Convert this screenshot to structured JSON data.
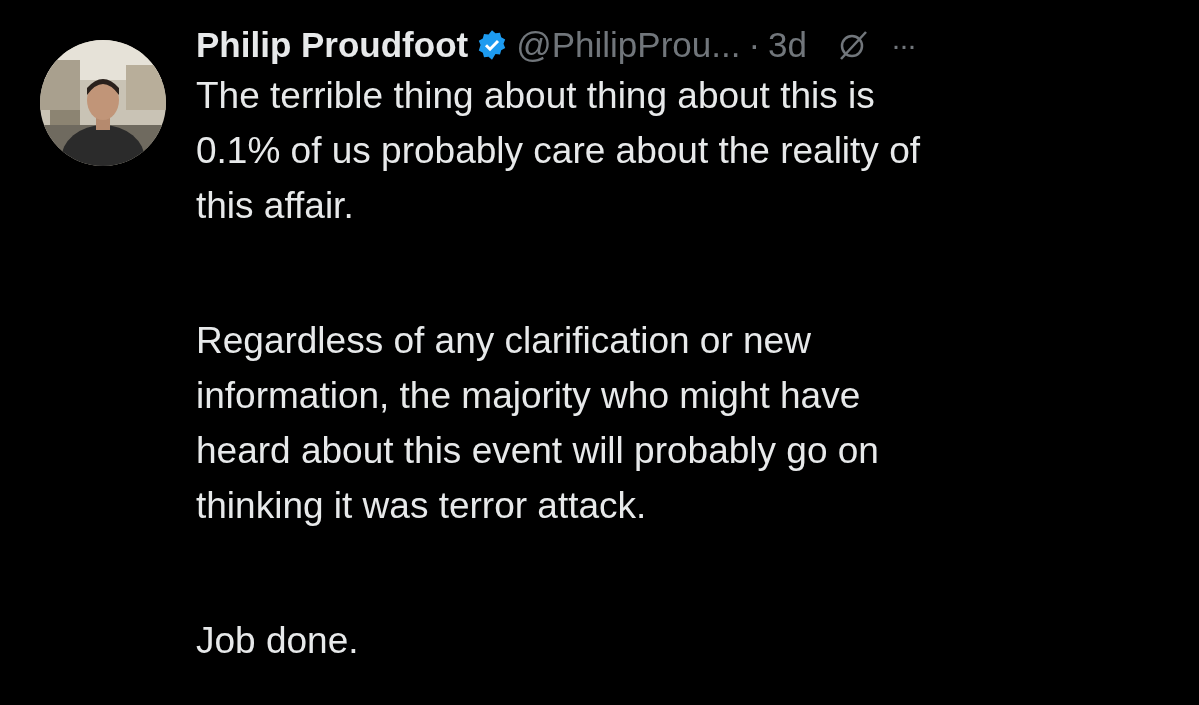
{
  "post": {
    "author": "Philip Proudfoot",
    "verified": true,
    "handle": "@PhilipProu...",
    "separator": "·",
    "time": "3d",
    "more": "···",
    "paragraphs": [
      [
        "The terrible thing about thing about this is",
        "0.1% of us probably care about the reality of",
        "this affair."
      ],
      [
        "Regardless of any clarification or new",
        "information, the majority who might have",
        "heard about this event will probably go on",
        "thinking it was terror attack."
      ],
      [
        "Job done."
      ]
    ]
  }
}
